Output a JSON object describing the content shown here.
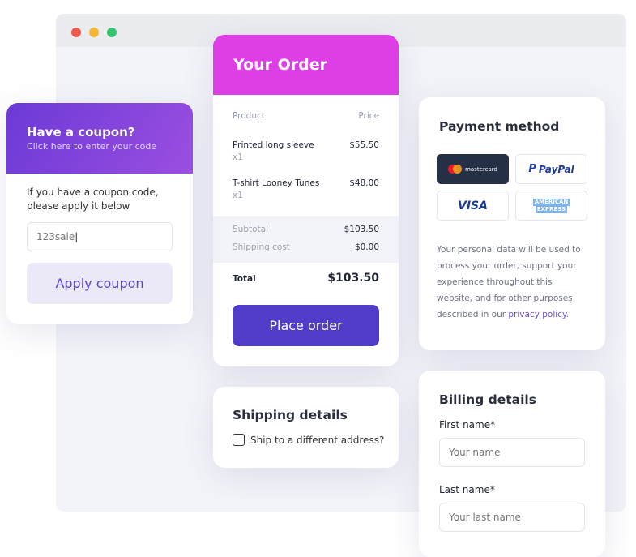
{
  "browser": {
    "dots": [
      "#ef5b4f",
      "#f5b731",
      "#35c56e"
    ]
  },
  "order": {
    "title": "Your Order",
    "col_product": "Product",
    "col_price": "Price",
    "items": [
      {
        "name": "Printed long sleeve",
        "qty": "x1",
        "price": "$55.50"
      },
      {
        "name": "T-shirt Looney Tunes",
        "qty": "x1",
        "price": "$48.00"
      }
    ],
    "subtotal_label": "Subtotal",
    "subtotal": "$103.50",
    "shipping_label": "Shipping cost",
    "shipping": "$0.00",
    "total_label": "Total",
    "total": "$103.50",
    "place_order": "Place order",
    "accent": "#dd3ee6",
    "button_color": "#4f3cc9"
  },
  "coupon": {
    "title": "Have a coupon?",
    "subtitle": "Click here to enter your code",
    "text1": "If you have a coupon code,",
    "text2": "please apply it below",
    "value": "123sale",
    "apply": "Apply coupon"
  },
  "payment": {
    "title": "Payment method",
    "methods": [
      "mastercard",
      "PayPal",
      "VISA",
      "AMERICAN",
      "EXPRESS"
    ],
    "text": [
      "Your personal data will be used to",
      "process your order, support your",
      "experience throughout this",
      "website, and for other purposes",
      "described in our "
    ],
    "link": "privacy policy",
    "link_end": "."
  },
  "shipping": {
    "title": "Shipping details",
    "checkbox": "Ship to a different address?",
    "checked": false
  },
  "billing": {
    "title": "Billing details",
    "first_label": "First name*",
    "first_placeholder": "Your name",
    "last_label": "Last name*",
    "last_placeholder": "Your last name"
  }
}
